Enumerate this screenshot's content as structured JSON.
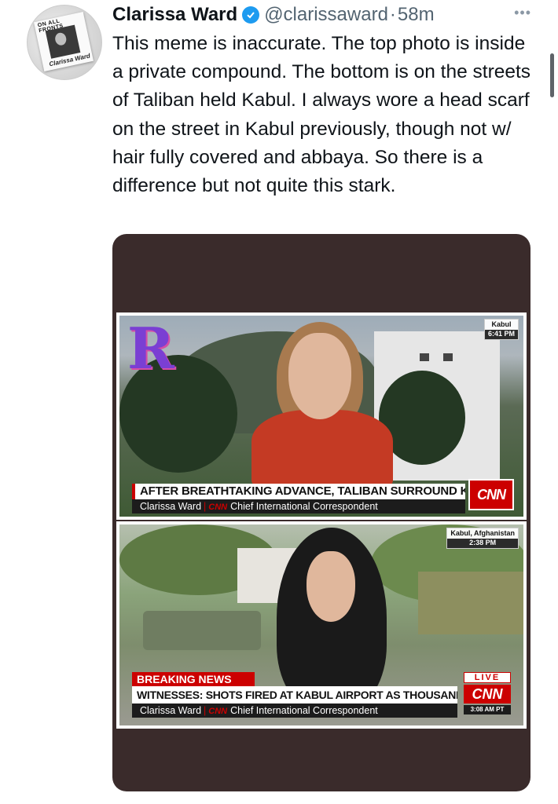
{
  "tweet": {
    "avatar_text_top": "ON ALL FRONTS",
    "avatar_text_bottom": "Clarissa Ward",
    "name": "Clarissa Ward",
    "handle": "@clarissaward",
    "separator": "·",
    "time": "58m",
    "more": "•••",
    "text": "This meme is inaccurate. The top photo is inside a private compound. The bottom is on the streets of Taliban held Kabul. I always wore a head scarf on the street in Kabul previously, though not w/ hair fully covered and abbaya. So there is a difference but not quite this stark."
  },
  "media": {
    "top_panel": {
      "location": "Kabul",
      "time": "6:41 PM",
      "headline": "AFTER BREATHTAKING ADVANCE, TALIBAN SURROUND KABUL",
      "reporter": "Clarissa Ward",
      "network_mini": "CNN",
      "title": "Chief International Correspondent",
      "network": "CNN",
      "watermark": "R"
    },
    "bottom_panel": {
      "location": "Kabul, Afghanistan",
      "time": "2:38 PM",
      "breaking": "BREAKING NEWS",
      "headline": "WITNESSES: SHOTS FIRED AT KABUL AIRPORT AS THOUSANDS TRY TO LEAVE",
      "reporter": "Clarissa Ward",
      "network_mini": "CNN",
      "title": "Chief International Correspondent",
      "live": "LIVE",
      "network": "CNN",
      "clock": "3:08 AM PT"
    }
  },
  "colors": {
    "verified": "#1d9bf0",
    "media_bg": "#3a2b2b",
    "cnn_red": "#cc0000"
  },
  "icons": {
    "verified": "verified-badge-icon",
    "more": "more-options-icon"
  }
}
